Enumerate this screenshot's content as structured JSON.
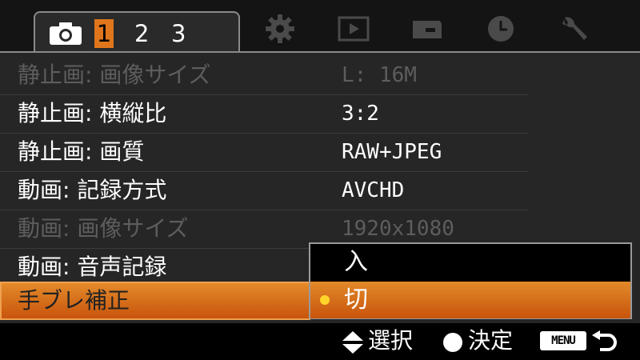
{
  "tabs": {
    "camera_pages": [
      "1",
      "2",
      "3"
    ],
    "selected_page": "1",
    "icons": [
      "camera-icon",
      "gear-icon",
      "playback-icon",
      "memory-card-icon",
      "clock-icon",
      "wrench-icon"
    ]
  },
  "menu": {
    "rows": [
      {
        "label": "静止画: 画像サイズ",
        "value": "L: 16M",
        "state": "disabled"
      },
      {
        "label": "静止画: 横縦比",
        "value": "3:2",
        "state": "normal"
      },
      {
        "label": "静止画: 画質",
        "value": "RAW+JPEG",
        "state": "normal"
      },
      {
        "label": "動画: 記録方式",
        "value": "AVCHD",
        "state": "normal"
      },
      {
        "label": "動画: 画像サイズ",
        "value": "1920x1080",
        "state": "disabled"
      },
      {
        "label": "動画: 音声記録",
        "value": "",
        "state": "normal"
      },
      {
        "label": "手ブレ補正",
        "value": "",
        "state": "selected"
      }
    ]
  },
  "dropdown": {
    "options": [
      "入",
      "切"
    ],
    "selected": "切"
  },
  "footer": {
    "select_label": "選択",
    "confirm_label": "決定",
    "menu_key": "MENU"
  },
  "colors": {
    "accent": "#e0761c",
    "highlight_dot": "#ffd52a",
    "dim_text": "#5d5d5d",
    "background": "#262626"
  }
}
